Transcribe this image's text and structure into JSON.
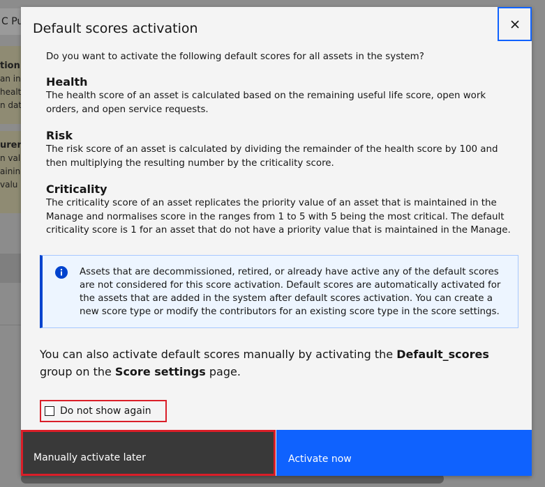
{
  "background": {
    "tab_label": "C Pu",
    "card1": {
      "title": "tion c",
      "lines": [
        "an ins",
        "healt",
        "n dat"
      ]
    },
    "card2": {
      "title": "urer",
      "lines": [
        "n valu",
        "ainin",
        " valu"
      ]
    }
  },
  "modal": {
    "title": "Default scores activation",
    "close_icon": "close-icon",
    "intro": "Do you want to activate the following default scores for all assets in the system?",
    "sections": [
      {
        "heading": "Health",
        "text": "The health score of an asset is calculated based on the remaining useful life score, open work orders, and open service requests."
      },
      {
        "heading": "Risk",
        "text": "The risk score of an asset is calculated by dividing the remainder of the health score by 100 and then multiplying the resulting number by the criticality score."
      },
      {
        "heading": "Criticality",
        "text": "The criticality score of an asset replicates the priority value of an asset that is maintained in the Manage and normalises score in the ranges from 1 to 5 with 5 being the most critical. The default criticality score is 1 for an asset that do not have a priority value that is maintained in the Manage."
      }
    ],
    "notification": {
      "icon": "info-icon",
      "text": "Assets that are decommissioned, retired, or already have active any of the default scores are not considered for this score activation. Default scores are automatically activated for the assets that are added in the system after default scores activation. You can create a new score type or modify the contributors for an existing score type in the score settings."
    },
    "manual": {
      "prefix": "You can also activate default scores manually by activating the ",
      "group_name": "Default_scores",
      "middle": " group on the ",
      "page_name": "Score settings",
      "suffix": " page."
    },
    "checkbox": {
      "label": "Do not show again",
      "checked": false
    },
    "buttons": {
      "secondary": "Manually activate later",
      "primary": "Activate now"
    },
    "colors": {
      "primary": "#0f62fe",
      "secondary": "#393939",
      "highlight": "#da1e28",
      "info_border": "#0043ce"
    }
  }
}
